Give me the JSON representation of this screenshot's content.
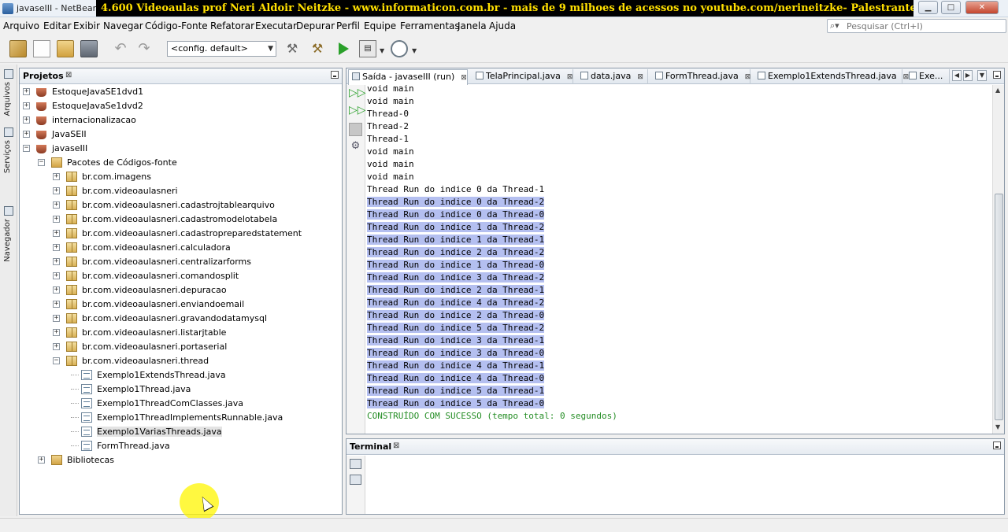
{
  "window": {
    "title": "javaseIII - NetBeans",
    "banner": "4.600 Videoaulas prof Neri Aldoir Neitzke - www.informaticon.com.br - mais de 9 milhoes de acessos no youtube.com/nerineitzke- Palestrante Internacional",
    "minimize_glyph": "▁",
    "maximize_glyph": "□",
    "close_glyph": "✕"
  },
  "menubar": {
    "items": [
      "Arquivo",
      "Editar",
      "Exibir",
      "Navegar",
      "Código-Fonte",
      "Refatorar",
      "Executar",
      "Depurar",
      "Perfil",
      "Equipe",
      "Ferramentas",
      "Janela",
      "Ajuda"
    ],
    "search_placeholder": "Pesquisar (Ctrl+I)"
  },
  "toolbar": {
    "config": "<config. default>",
    "icons": [
      "new-project-icon",
      "new-file-icon",
      "open-project-icon",
      "save-all-icon",
      "undo-icon",
      "redo-icon",
      "build-icon",
      "clean-build-icon",
      "run-icon",
      "debug-icon",
      "profile-icon"
    ]
  },
  "side_tabs": [
    "Arquivos",
    "Serviços",
    "Navegador"
  ],
  "projects": {
    "tab_label": "Projetos",
    "tree": [
      {
        "label": "EstoqueJavaSE1dvd1",
        "level": 0,
        "icon": "project",
        "expander": "+"
      },
      {
        "label": "EstoqueJavaSe1dvd2",
        "level": 0,
        "icon": "project",
        "expander": "+"
      },
      {
        "label": "internacionalizacao",
        "level": 0,
        "icon": "project",
        "expander": "+"
      },
      {
        "label": "JavaSEII",
        "level": 0,
        "icon": "project",
        "expander": "+"
      },
      {
        "label": "javaseIII",
        "level": 0,
        "icon": "project",
        "expander": "−"
      },
      {
        "label": "Pacotes de Códigos-fonte",
        "level": 1,
        "icon": "folder",
        "expander": "−"
      },
      {
        "label": "br.com.imagens",
        "level": 2,
        "icon": "package",
        "expander": "+"
      },
      {
        "label": "br.com.videoaulasneri",
        "level": 2,
        "icon": "package",
        "expander": "+"
      },
      {
        "label": "br.com.videoaulasneri.cadastrojtablearquivo",
        "level": 2,
        "icon": "package",
        "expander": "+"
      },
      {
        "label": "br.com.videoaulasneri.cadastromodelotabela",
        "level": 2,
        "icon": "package",
        "expander": "+"
      },
      {
        "label": "br.com.videoaulasneri.cadastropreparedstatement",
        "level": 2,
        "icon": "package",
        "expander": "+"
      },
      {
        "label": "br.com.videoaulasneri.calculadora",
        "level": 2,
        "icon": "package",
        "expander": "+"
      },
      {
        "label": "br.com.videoaulasneri.centralizarforms",
        "level": 2,
        "icon": "package",
        "expander": "+"
      },
      {
        "label": "br.com.videoaulasneri.comandosplit",
        "level": 2,
        "icon": "package",
        "expander": "+"
      },
      {
        "label": "br.com.videoaulasneri.depuracao",
        "level": 2,
        "icon": "package",
        "expander": "+"
      },
      {
        "label": "br.com.videoaulasneri.enviandoemail",
        "level": 2,
        "icon": "package",
        "expander": "+"
      },
      {
        "label": "br.com.videoaulasneri.gravandodatamysql",
        "level": 2,
        "icon": "package",
        "expander": "+"
      },
      {
        "label": "br.com.videoaulasneri.listarjtable",
        "level": 2,
        "icon": "package",
        "expander": "+"
      },
      {
        "label": "br.com.videoaulasneri.portaserial",
        "level": 2,
        "icon": "package",
        "expander": "+"
      },
      {
        "label": "br.com.videoaulasneri.thread",
        "level": 2,
        "icon": "package",
        "expander": "−"
      },
      {
        "label": "Exemplo1ExtendsThread.java",
        "level": 3,
        "icon": "java",
        "expander": ""
      },
      {
        "label": "Exemplo1Thread.java",
        "level": 3,
        "icon": "java",
        "expander": ""
      },
      {
        "label": "Exemplo1ThreadComClasses.java",
        "level": 3,
        "icon": "java",
        "expander": ""
      },
      {
        "label": "Exemplo1ThreadImplementsRunnable.java",
        "level": 3,
        "icon": "java",
        "expander": ""
      },
      {
        "label": "Exemplo1VariasThreads.java",
        "level": 3,
        "icon": "java",
        "expander": "",
        "selected": true
      },
      {
        "label": "FormThread.java",
        "level": 3,
        "icon": "java",
        "expander": ""
      },
      {
        "label": "Bibliotecas",
        "level": 1,
        "icon": "folder",
        "expander": "+"
      }
    ]
  },
  "output": {
    "tabs": [
      {
        "label": "Saída - javaseIII (run)",
        "active": true,
        "icon": "out"
      },
      {
        "label": "TelaPrincipal.java",
        "active": false,
        "icon": "java"
      },
      {
        "label": "data.java",
        "active": false,
        "icon": "java"
      },
      {
        "label": "FormThread.java",
        "active": false,
        "icon": "java"
      },
      {
        "label": "Exemplo1ExtendsThread.java",
        "active": false,
        "icon": "java"
      },
      {
        "label": "Exe...",
        "active": false,
        "icon": "java"
      }
    ],
    "lines": [
      {
        "text": "void main",
        "selected": false
      },
      {
        "text": "void main",
        "selected": false
      },
      {
        "text": "Thread-0",
        "selected": false
      },
      {
        "text": "Thread-2",
        "selected": false
      },
      {
        "text": "Thread-1",
        "selected": false
      },
      {
        "text": "void main",
        "selected": false
      },
      {
        "text": "void main",
        "selected": false
      },
      {
        "text": "void main",
        "selected": false
      },
      {
        "text": "Thread Run do indice 0 da Thread-1",
        "selected": false
      },
      {
        "text": "Thread Run do indice 0 da Thread-2",
        "selected": true
      },
      {
        "text": "Thread Run do indice 0 da Thread-0",
        "selected": true
      },
      {
        "text": "Thread Run do indice 1 da Thread-2",
        "selected": true
      },
      {
        "text": "Thread Run do indice 1 da Thread-1",
        "selected": true
      },
      {
        "text": "Thread Run do indice 2 da Thread-2",
        "selected": true
      },
      {
        "text": "Thread Run do indice 1 da Thread-0",
        "selected": true
      },
      {
        "text": "Thread Run do indice 3 da Thread-2",
        "selected": true
      },
      {
        "text": "Thread Run do indice 2 da Thread-1",
        "selected": true
      },
      {
        "text": "Thread Run do indice 4 da Thread-2",
        "selected": true
      },
      {
        "text": "Thread Run do indice 2 da Thread-0",
        "selected": true
      },
      {
        "text": "Thread Run do indice 5 da Thread-2",
        "selected": true
      },
      {
        "text": "Thread Run do indice 3 da Thread-1",
        "selected": true
      },
      {
        "text": "Thread Run do indice 3 da Thread-0",
        "selected": true
      },
      {
        "text": "Thread Run do indice 4 da Thread-1",
        "selected": true
      },
      {
        "text": "Thread Run do indice 4 da Thread-0",
        "selected": true
      },
      {
        "text": "Thread Run do indice 5 da Thread-1",
        "selected": true
      },
      {
        "text": "Thread Run do indice 5 da Thread-0",
        "selected": true
      }
    ],
    "success": "CONSTRUÍDO COM SUCESSO (tempo total: 0 segundos)"
  },
  "terminal": {
    "tab_label": "Terminal"
  },
  "colors": {
    "selection": "#b4bff0",
    "success_text": "#248d24",
    "banner_text": "#ffe000",
    "banner_bg": "#000000"
  }
}
